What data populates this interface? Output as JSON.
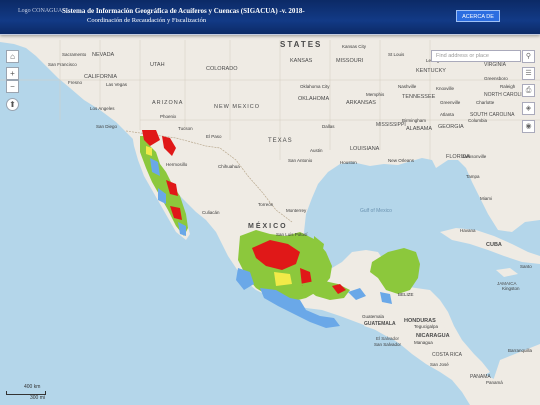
{
  "header": {
    "logo_alt": "Logo CONAGUA",
    "title": "Sistema de Información Geográfica de Acuíferos y Cuencas (SIGACUA) -v. 2018-",
    "subtitle": "Coordinación de Recaudación y Fiscalización",
    "about_button": "ACERCA DE"
  },
  "map_controls": {
    "home_icon": "home-icon",
    "zoom_in": "+",
    "zoom_out": "−",
    "locate_icon": "compass-icon"
  },
  "search": {
    "placeholder": "Find address or place"
  },
  "right_tools": [
    "search-icon",
    "basemap-icon",
    "print-icon",
    "layers-icon",
    "legend-icon"
  ],
  "scale": {
    "metric": "400 km",
    "imperial": "300 mi"
  },
  "place_labels": {
    "states": "STATES",
    "mexico": "MÉXICO",
    "gulf": "Gulf of Mexico",
    "cuba": "CUBA",
    "jamaica": "JAMAICA",
    "honduras": "HONDURAS",
    "nicaragua": "NICARAGUA",
    "guatemala": "GUATEMALA",
    "el_salvador": "El Salvador",
    "costa_rica": "COSTA RICA",
    "panama": "PANAMA",
    "texas": "TEXAS",
    "arizona": "ARIZONA",
    "new_mexico": "NEW MEXICO",
    "oklahoma": "OKLAHOMA",
    "arkansas": "ARKANSAS",
    "louisiana": "LOUISIANA",
    "mississippi": "MISSISSIPPI",
    "alabama": "ALABAMA",
    "georgia": "GEORGIA",
    "florida": "FLORIDA",
    "tennessee": "TENNESSEE",
    "kentucky": "KENTUCKY",
    "missouri": "MISSOURI",
    "kansas": "KANSAS",
    "colorado": "COLORADO",
    "utah": "UTAH",
    "nevada": "NEVADA",
    "california": "CALIFORNIA",
    "south_carolina": "SOUTH CAROLINA",
    "north_carolina": "NORTH CAROLINA",
    "virginia": "VIRGINIA",
    "cities": {
      "sacramento": "Sacramento",
      "san_francisco": "San Francisco",
      "fresno": "Fresno",
      "las_vegas": "Las Vegas",
      "los_angeles": "Los Angeles",
      "san_diego": "San Diego",
      "phoenix": "Phoenix",
      "tucson": "Tucson",
      "el_paso": "El Paso",
      "chihuahua": "Chihuahua",
      "hermosillo": "Hermosillo",
      "culiacan": "Culiacán",
      "monterrey": "Monterrey",
      "torreon": "Torreón",
      "san_luis": "San Luis Potosí",
      "dallas": "Dallas",
      "austin": "Austin",
      "san_antonio": "San Antonio",
      "houston": "Houston",
      "new_orleans": "New Orleans",
      "memphis": "Memphis",
      "nashville": "Nashville",
      "atlanta": "Atlanta",
      "birmingham": "Birmingham",
      "oklahoma_city": "Oklahoma City",
      "kansas_city": "Kansas City",
      "st_louis": "St Louis",
      "jacksonville": "Jacksonville",
      "tampa": "Tampa",
      "miami": "Miami",
      "havana": "Havana",
      "charlotte": "Charlotte",
      "raleigh": "Raleigh",
      "greensboro": "Greensboro",
      "lexington": "Lexington",
      "knoxville": "Knoxville",
      "greenville": "Greenville",
      "columbia": "Columbia",
      "guatemala_city": "Guatemala",
      "tegucigalpa": "Tegucigalpa",
      "managua": "Managua",
      "san_jose": "San José",
      "panama_city": "Panamá",
      "kingston": "Kingston",
      "belize": "BELIZE",
      "san_salvador": "San Salvador",
      "barranquilla": "Barranquilla",
      "santo_domingo": "Santo"
    }
  },
  "colors": {
    "land": "#efebe4",
    "water": "#b4d6ea",
    "aquifer_green": "#8cc83c",
    "aquifer_red": "#e01818",
    "aquifer_blue": "#6aa8e8",
    "aquifer_yellow": "#f2ea48",
    "header_bg": "#0c2a66"
  }
}
